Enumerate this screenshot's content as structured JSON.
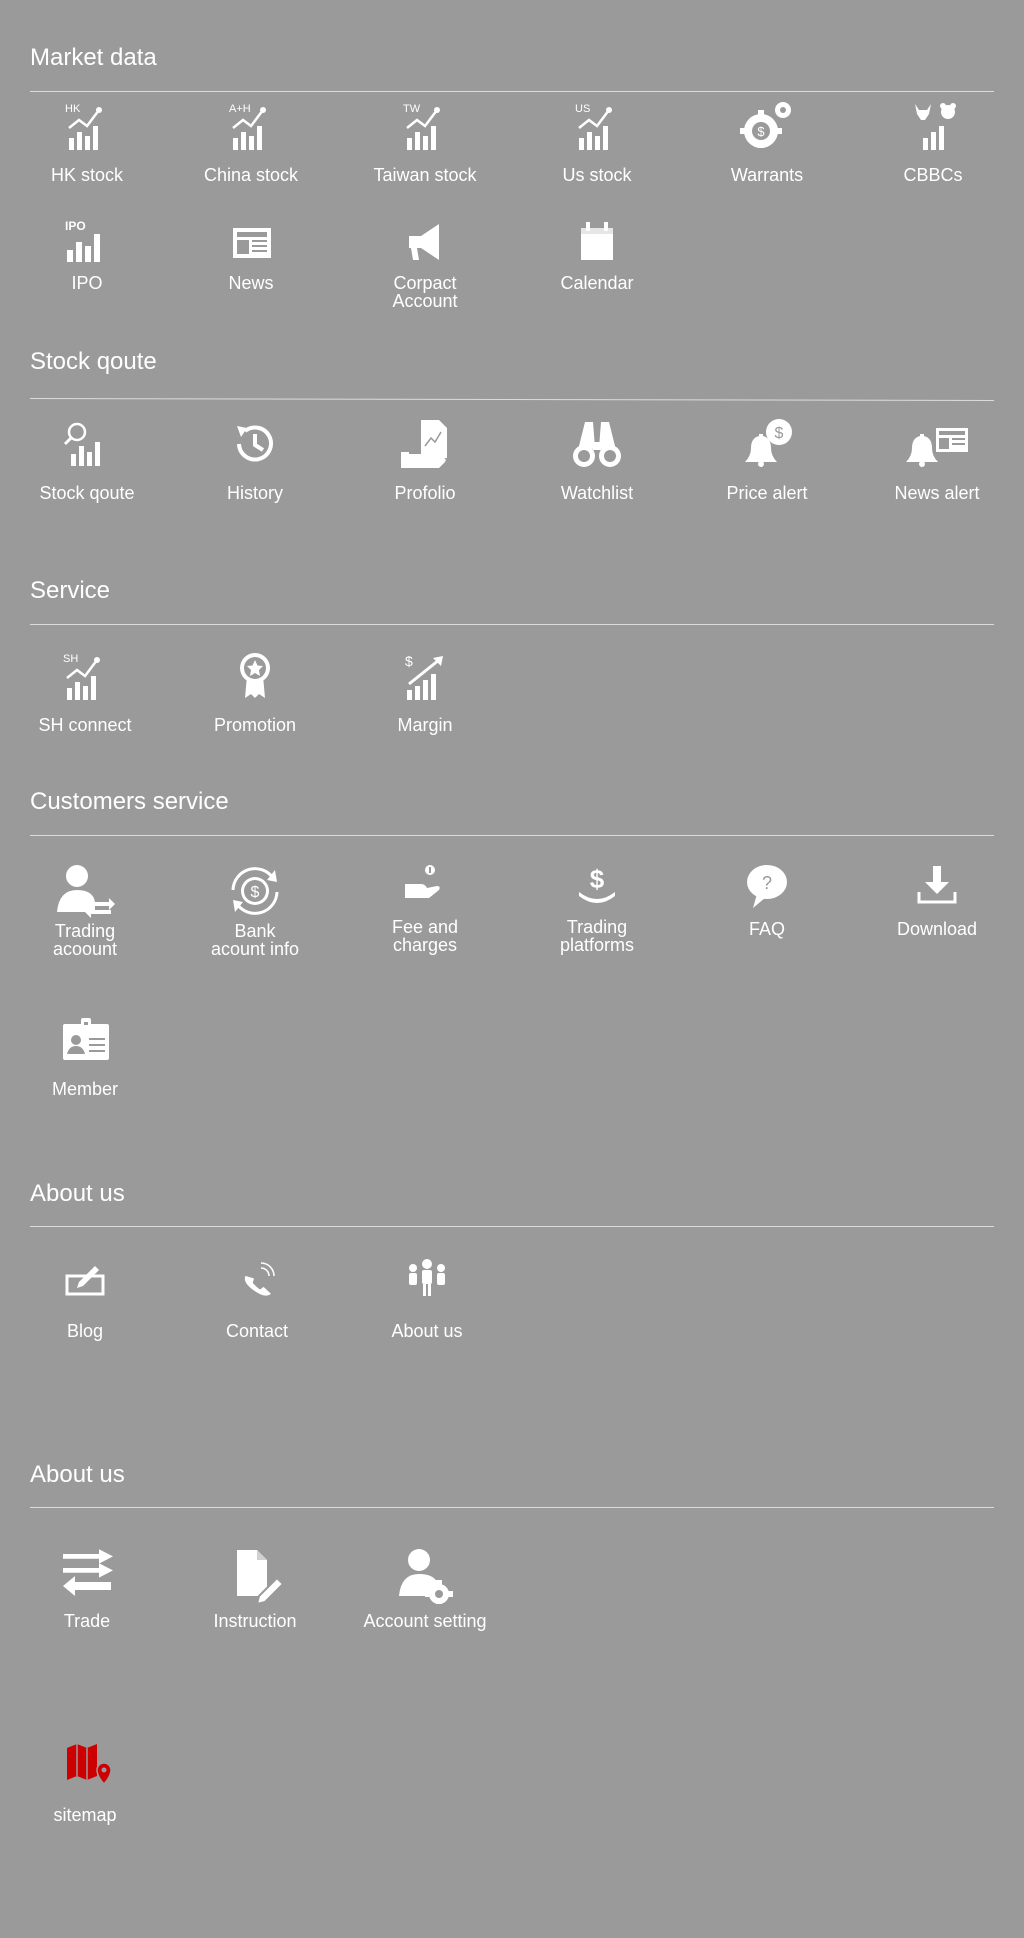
{
  "sections": {
    "market_data": {
      "title": "Market data",
      "items": [
        {
          "label": "HK stock",
          "icon": "hk-stock-chart-icon",
          "tag": "HK"
        },
        {
          "label": "China stock",
          "icon": "china-stock-chart-icon",
          "tag": "A+H"
        },
        {
          "label": "Taiwan stock",
          "icon": "taiwan-stock-chart-icon",
          "tag": "TW"
        },
        {
          "label": "Us stock",
          "icon": "us-stock-chart-icon",
          "tag": "US"
        },
        {
          "label": "Warrants",
          "icon": "gear-dollar-icon"
        },
        {
          "label": "CBBCs",
          "icon": "bull-bear-chart-icon"
        },
        {
          "label": "IPO",
          "icon": "ipo-chart-icon",
          "tag": "IPO"
        },
        {
          "label": "News",
          "icon": "newspaper-icon"
        },
        {
          "label_line1": "Corpact",
          "label_line2": "Account",
          "icon": "megaphone-icon"
        },
        {
          "label": "Calendar",
          "icon": "calendar-icon"
        }
      ]
    },
    "stock_qoute": {
      "title": "Stock qoute",
      "items": [
        {
          "label": "Stock qoute",
          "icon": "search-chart-icon"
        },
        {
          "label": "History",
          "icon": "history-icon"
        },
        {
          "label": "Profolio",
          "icon": "portfolio-icon"
        },
        {
          "label": "Watchlist",
          "icon": "binoculars-icon"
        },
        {
          "label": "Price alert",
          "icon": "bell-dollar-icon"
        },
        {
          "label": "News alert",
          "icon": "bell-news-icon"
        }
      ]
    },
    "service": {
      "title": "Service",
      "items": [
        {
          "label": "SH connect",
          "icon": "sh-chart-icon",
          "tag": "SH"
        },
        {
          "label": "Promotion",
          "icon": "award-ribbon-icon"
        },
        {
          "label": "Margin",
          "icon": "dollar-chart-icon",
          "tag": "$"
        }
      ]
    },
    "customers_service": {
      "title": "Customers service",
      "items": [
        {
          "label_line1": "Trading",
          "label_line2": "acoount",
          "icon": "user-transfer-icon"
        },
        {
          "label_line1": "Bank",
          "label_line2": "acount info",
          "icon": "dollar-cycle-icon"
        },
        {
          "label_line1": "Fee and",
          "label_line2": "charges",
          "icon": "hand-coin-icon"
        },
        {
          "label_line1": "Trading",
          "label_line2": "platforms",
          "icon": "hand-dollar-icon"
        },
        {
          "label": "FAQ",
          "icon": "question-bubble-icon"
        },
        {
          "label": "Download",
          "icon": "download-icon"
        },
        {
          "label": "Member",
          "icon": "member-card-icon"
        }
      ]
    },
    "about_us_1": {
      "title": "About us",
      "items": [
        {
          "label": "Blog",
          "icon": "blog-pen-icon"
        },
        {
          "label": "Contact",
          "icon": "phone-icon"
        },
        {
          "label": "About us",
          "icon": "people-group-icon"
        }
      ]
    },
    "about_us_2": {
      "title": "About us",
      "items": [
        {
          "label": "Trade",
          "icon": "swap-arrows-icon"
        },
        {
          "label": "Instruction",
          "icon": "document-pencil-icon"
        },
        {
          "label": "Account setting",
          "icon": "user-gear-icon"
        }
      ]
    }
  },
  "sitemap": {
    "label": "sitemap",
    "icon": "map-pin-icon",
    "color": "#cc0000"
  },
  "colors": {
    "background": "#9a9a9a",
    "text": "#ffffff",
    "rule": "#dcdcdc",
    "accent": "#cc0000"
  }
}
